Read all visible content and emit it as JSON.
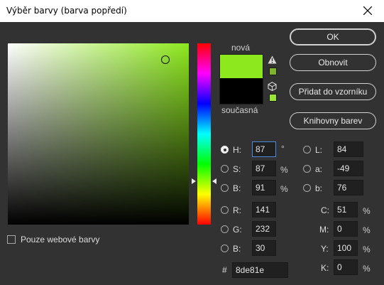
{
  "window": {
    "title": "Výběr barvy (barva popředí)"
  },
  "preview": {
    "new_label": "nová",
    "current_label": "současná",
    "new_color": "#8de81e",
    "current_color": "#000000"
  },
  "buttons": {
    "ok": "OK",
    "reset": "Obnovit",
    "add_to_swatches": "Přidat do vzorníku",
    "color_libraries": "Knihovny barev"
  },
  "web_only": {
    "label": "Pouze webové barvy",
    "checked": false
  },
  "hsb": {
    "h": {
      "label": "H:",
      "value": "87",
      "unit": "°",
      "selected": true
    },
    "s": {
      "label": "S:",
      "value": "87",
      "unit": "%"
    },
    "b": {
      "label": "B:",
      "value": "91",
      "unit": "%"
    }
  },
  "rgb": {
    "r": {
      "label": "R:",
      "value": "141"
    },
    "g": {
      "label": "G:",
      "value": "232"
    },
    "b": {
      "label": "B:",
      "value": "30"
    }
  },
  "lab": {
    "l": {
      "label": "L:",
      "value": "84"
    },
    "a": {
      "label": "a:",
      "value": "-49"
    },
    "b": {
      "label": "b:",
      "value": "76"
    }
  },
  "cmyk": {
    "c": {
      "label": "C:",
      "value": "51",
      "unit": "%"
    },
    "m": {
      "label": "M:",
      "value": "0",
      "unit": "%"
    },
    "y": {
      "label": "Y:",
      "value": "100",
      "unit": "%"
    },
    "k": {
      "label": "K:",
      "value": "0",
      "unit": "%"
    }
  },
  "hex": {
    "symbol": "#",
    "value": "8de81e"
  },
  "icons": {
    "close": "close-icon",
    "gamut_warning": "warning-triangle-icon",
    "web_safe": "cube-icon"
  }
}
